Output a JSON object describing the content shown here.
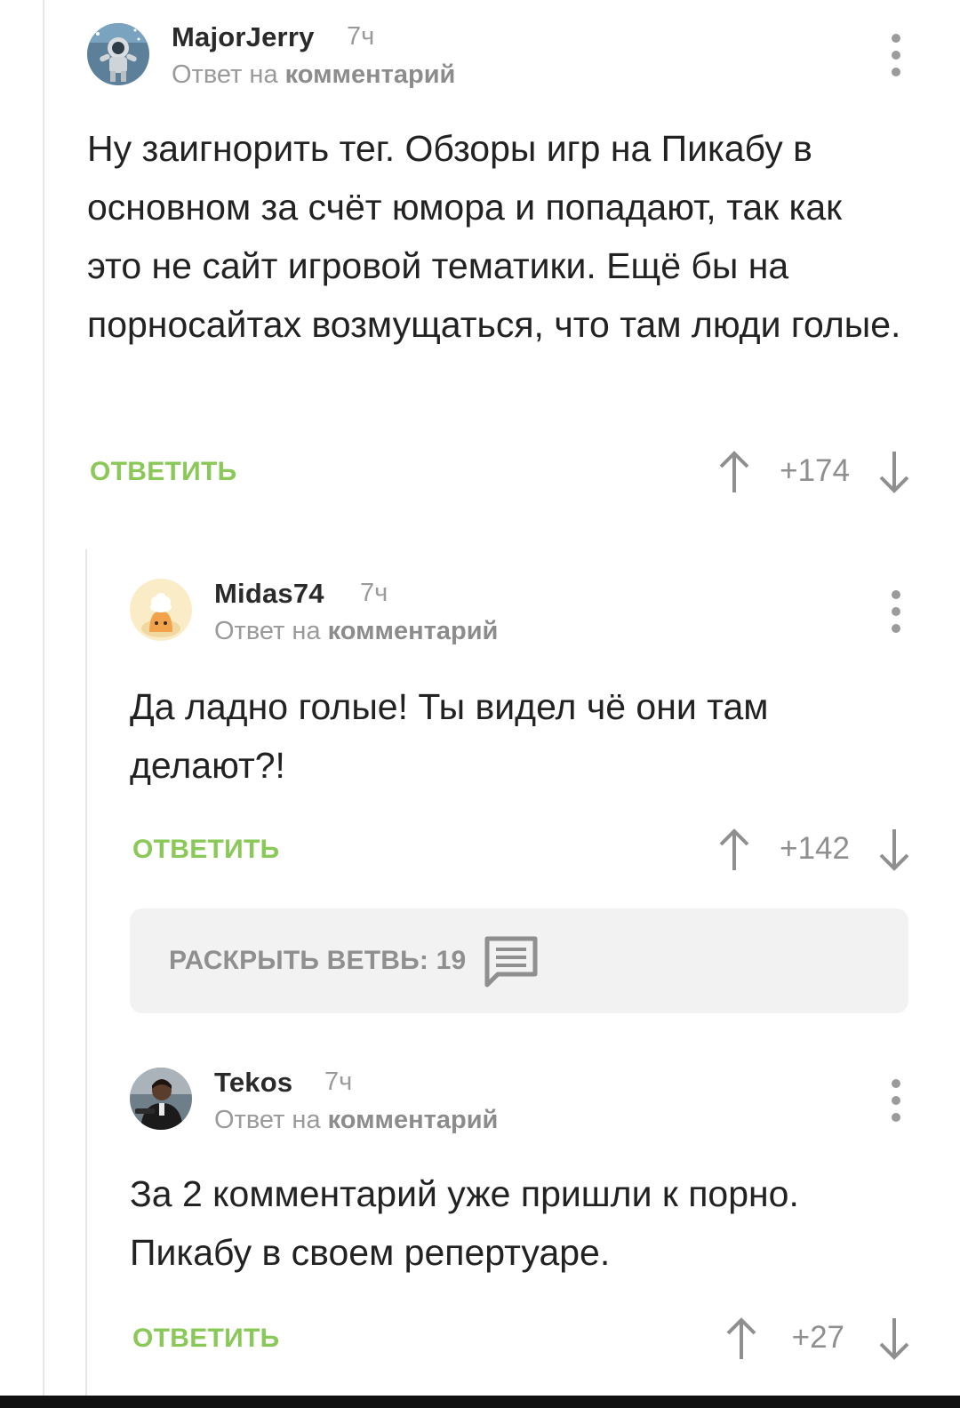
{
  "comments": [
    {
      "username": "MajorJerry",
      "time": "7ч",
      "reply_prefix": "Ответ на ",
      "reply_link": "комментарий",
      "text": "Ну заигнорить тег. Обзоры игр на Пикабу в основном за счёт юмора и попадают, так как это не сайт игровой тематики. Ещё бы на порносайтах возмущаться, что там люди голые.",
      "reply_label": "ОТВЕТИТЬ",
      "score": "+174",
      "avatar": "astronaut-avatar"
    },
    {
      "username": "Midas74",
      "time": "7ч",
      "reply_prefix": "Ответ на ",
      "reply_link": "комментарий",
      "text": "Да ладно голые! Ты видел чё они там делают?!",
      "reply_label": "ОТВЕТИТЬ",
      "score": "+142",
      "avatar": "chef-avatar"
    },
    {
      "username": "Tekos",
      "time": "7ч",
      "reply_prefix": "Ответ на ",
      "reply_link": "комментарий",
      "text": "За 2 комментарий уже пришли к порно. Пикабу в своем репертуаре.",
      "reply_label": "ОТВЕТИТЬ",
      "score": "+27",
      "avatar": "person-avatar"
    }
  ],
  "expand_branch": {
    "label": "РАСКРЫТЬ ВЕТВЬ: 19",
    "icon": "comments-icon"
  },
  "colors": {
    "accent_green": "#8ac858",
    "muted_gray": "#9a9a9a",
    "text": "#222222"
  }
}
